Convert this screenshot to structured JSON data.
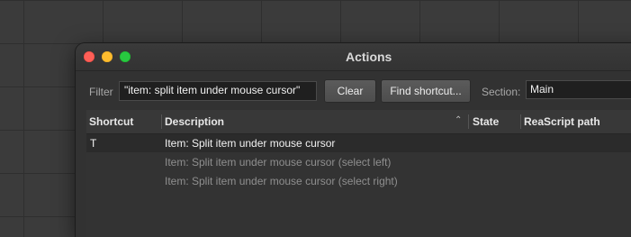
{
  "window": {
    "title": "Actions"
  },
  "toolbar": {
    "filter_label": "Filter",
    "filter_value": "\"item: split item under mouse cursor\"",
    "clear_label": "Clear",
    "find_shortcut_label": "Find shortcut...",
    "section_label": "Section:",
    "section_value": "Main"
  },
  "table": {
    "columns": [
      "Shortcut",
      "Description",
      "State",
      "ReaScript path"
    ],
    "sort_icon": "chevron-up-icon",
    "rows": [
      {
        "shortcut": "T",
        "description": "Item: Split item under mouse cursor",
        "state": "",
        "path": "",
        "selected": true
      },
      {
        "shortcut": "",
        "description": "Item: Split item under mouse cursor (select left)",
        "state": "",
        "path": "",
        "selected": false
      },
      {
        "shortcut": "",
        "description": "Item: Split item under mouse cursor (select right)",
        "state": "",
        "path": "",
        "selected": false
      }
    ]
  },
  "colors": {
    "close": "#fe5f57",
    "minimize": "#febc2e",
    "maximize": "#28c840",
    "background": "#3b3b3b",
    "panel": "#323232"
  }
}
